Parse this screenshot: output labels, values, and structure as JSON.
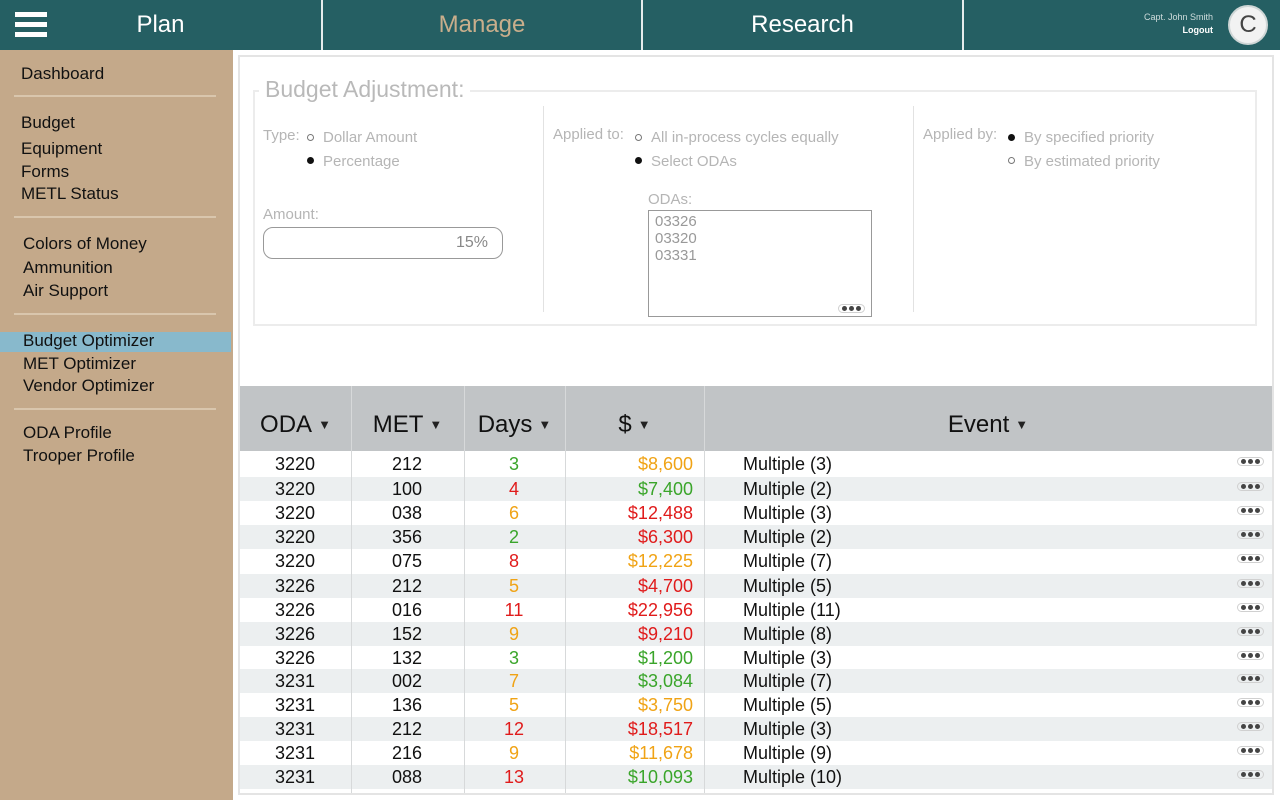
{
  "topnav": {
    "tabs": [
      {
        "label": "Plan"
      },
      {
        "label": "Manage"
      },
      {
        "label": "Research"
      }
    ],
    "user_name": "Capt. John Smith",
    "logout_label": "Logout",
    "avatar_initial": "C",
    "icons": {
      "menu": "hamburger-icon"
    }
  },
  "sidebar": {
    "items": [
      {
        "label": "Dashboard"
      },
      {
        "label": "Budget"
      },
      {
        "label": "Equipment"
      },
      {
        "label": "Forms"
      },
      {
        "label": "METL Status"
      },
      {
        "label": "Colors of Money"
      },
      {
        "label": "Ammunition"
      },
      {
        "label": "Air Support"
      },
      {
        "label": "Budget Optimizer"
      },
      {
        "label": "MET Optimizer"
      },
      {
        "label": "Vendor Optimizer"
      },
      {
        "label": "ODA Profile"
      },
      {
        "label": "Trooper Profile"
      }
    ],
    "active_item": "Budget Optimizer"
  },
  "budget_adjustment": {
    "title": "Budget Adjustment:",
    "type_label": "Type:",
    "type_options": [
      {
        "label": "Dollar Amount",
        "selected": false
      },
      {
        "label": "Percentage",
        "selected": true
      }
    ],
    "amount_label": "Amount:",
    "amount_value": "15%",
    "applied_to_label": "Applied to:",
    "applied_to_options": [
      {
        "label": "All in-process cycles equally",
        "selected": false
      },
      {
        "label": "Select ODAs",
        "selected": true
      }
    ],
    "odas_label": "ODAs:",
    "odas": [
      "03326",
      "03320",
      "03331"
    ],
    "applied_by_label": "Applied by:",
    "applied_by_options": [
      {
        "label": "By specified priority",
        "selected": true
      },
      {
        "label": "By estimated priority",
        "selected": false
      }
    ]
  },
  "table": {
    "columns": [
      "ODA",
      "MET",
      "Days",
      "$",
      "Event"
    ],
    "sort_icon": "sort-filter-icon",
    "status_colors": {
      "green": "#3aa52a",
      "red": "#e01b1b",
      "orange": "#f0a315"
    },
    "rows": [
      {
        "oda": "3220",
        "met": "212",
        "days": "3",
        "days_status": "green",
        "amount": "$8,600",
        "amount_status": "orange",
        "event": "Multiple (3)"
      },
      {
        "oda": "3220",
        "met": "100",
        "days": "4",
        "days_status": "red",
        "amount": "$7,400",
        "amount_status": "green",
        "event": "Multiple (2)"
      },
      {
        "oda": "3220",
        "met": "038",
        "days": "6",
        "days_status": "orange",
        "amount": "$12,488",
        "amount_status": "red",
        "event": "Multiple (3)"
      },
      {
        "oda": "3220",
        "met": "356",
        "days": "2",
        "days_status": "green",
        "amount": "$6,300",
        "amount_status": "red",
        "event": "Multiple (2)"
      },
      {
        "oda": "3220",
        "met": "075",
        "days": "8",
        "days_status": "red",
        "amount": "$12,225",
        "amount_status": "orange",
        "event": "Multiple (7)"
      },
      {
        "oda": "3226",
        "met": "212",
        "days": "5",
        "days_status": "orange",
        "amount": "$4,700",
        "amount_status": "red",
        "event": "Multiple (5)"
      },
      {
        "oda": "3226",
        "met": "016",
        "days": "11",
        "days_status": "red",
        "amount": "$22,956",
        "amount_status": "red",
        "event": "Multiple (11)"
      },
      {
        "oda": "3226",
        "met": "152",
        "days": "9",
        "days_status": "orange",
        "amount": "$9,210",
        "amount_status": "red",
        "event": "Multiple (8)"
      },
      {
        "oda": "3226",
        "met": "132",
        "days": "3",
        "days_status": "green",
        "amount": "$1,200",
        "amount_status": "green",
        "event": "Multiple (3)"
      },
      {
        "oda": "3231",
        "met": "002",
        "days": "7",
        "days_status": "orange",
        "amount": "$3,084",
        "amount_status": "green",
        "event": "Multiple (7)"
      },
      {
        "oda": "3231",
        "met": "136",
        "days": "5",
        "days_status": "orange",
        "amount": "$3,750",
        "amount_status": "orange",
        "event": "Multiple (5)"
      },
      {
        "oda": "3231",
        "met": "212",
        "days": "12",
        "days_status": "red",
        "amount": "$18,517",
        "amount_status": "red",
        "event": "Multiple (3)"
      },
      {
        "oda": "3231",
        "met": "216",
        "days": "9",
        "days_status": "orange",
        "amount": "$11,678",
        "amount_status": "orange",
        "event": "Multiple (9)"
      },
      {
        "oda": "3231",
        "met": "088",
        "days": "13",
        "days_status": "red",
        "amount": "$10,093",
        "amount_status": "green",
        "event": "Multiple (10)"
      }
    ]
  }
}
